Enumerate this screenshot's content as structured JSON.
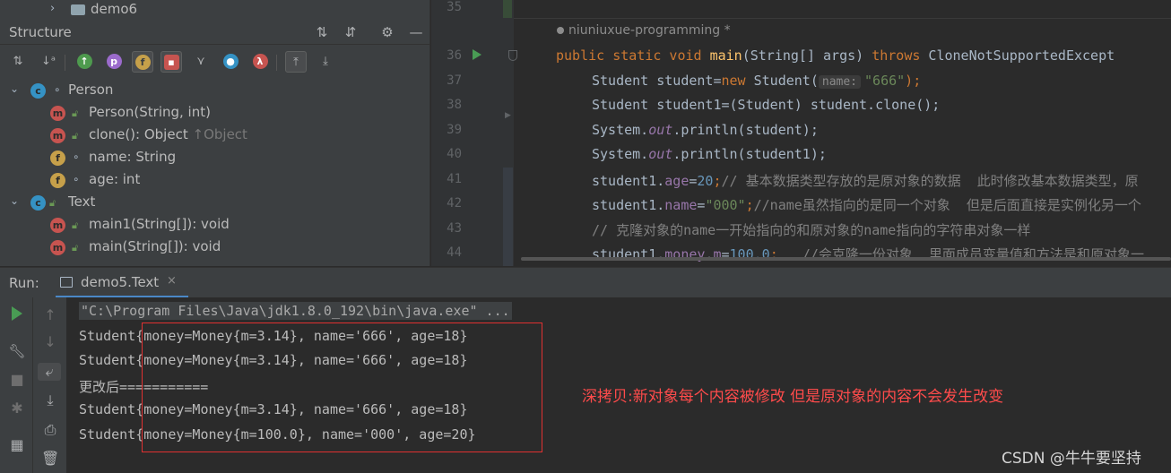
{
  "project_tree": {
    "folder_label": "demo6"
  },
  "structure_panel": {
    "title": "Structure",
    "toolbar_icons": [
      "sort-by-visibility-icon",
      "sort-alphabetically-icon",
      "show-inherited-icon",
      "show-properties-icon",
      "show-fields-icon",
      "show-non-public-icon",
      "show-lambdas-icon",
      "show-anonymous-icon",
      "navigate-from-source-icon",
      "navigate-to-source-icon"
    ],
    "tree": [
      {
        "label": "Person",
        "kind": "class",
        "level": 0,
        "expanded": true
      },
      {
        "label": "Person(String, int)",
        "kind": "method",
        "level": 1
      },
      {
        "label": "clone(): Object",
        "suffix": "↑Object",
        "kind": "method",
        "level": 1
      },
      {
        "label": "name: String",
        "kind": "field",
        "level": 1
      },
      {
        "label": "age: int",
        "kind": "field",
        "level": 1
      },
      {
        "label": "Text",
        "kind": "class",
        "level": 0,
        "expanded": true
      },
      {
        "label": "main1(String[]): void",
        "kind": "method",
        "level": 1
      },
      {
        "label": "main(String[]): void",
        "kind": "method",
        "level": 1
      }
    ]
  },
  "editor": {
    "author_hint": "niuniuxue-programming *",
    "line_numbers": [
      "35",
      "36",
      "37",
      "38",
      "39",
      "40",
      "41",
      "42",
      "43",
      "44"
    ],
    "lines": {
      "l36": {
        "kw1": "public static void ",
        "fn": "main",
        "rest": "(String[] args) ",
        "kw2": "throws",
        "tail": " CloneNotSupportedExcept"
      },
      "l37": {
        "a": "Student student=",
        "kw": "new",
        "b": " Student(",
        "hint": "name:",
        "str": "\"666\"",
        "c": ");"
      },
      "l38": {
        "a": "Student student1=(Student) student.clone();"
      },
      "l39": {
        "a": "System.",
        "out": "out",
        "b": ".println(student);"
      },
      "l40": {
        "a": "System.",
        "out": "out",
        "b": ".println(student1);"
      },
      "l41": {
        "a": "student1.",
        "fld": "age",
        "b": "=",
        "num": "20",
        "c": ";",
        "cmt": "// 基本数据类型存放的是原对象的数据  此时修改基本数据类型，原"
      },
      "l42": {
        "a": "student1.",
        "fld": "name",
        "b": "=",
        "str": "\"000\"",
        "c": ";",
        "cmt": "//name虽然指向的是同一个对象  但是后面直接是实例化另一个"
      },
      "l43": {
        "cmt": "// 克隆对象的name一开始指向的和原对象的name指向的字符串对象一样"
      },
      "l44": {
        "a": "student1.",
        "fld1": "money",
        "b": ".",
        "fld2": "m",
        "c": "=",
        "num": "100.0",
        "d": ";   ",
        "cmt": "//会克隆一份对象  里面成员变量值和方法是和原对象一"
      }
    }
  },
  "run_panel": {
    "label": "Run:",
    "tab_label": "demo5.Text",
    "tab_close": "×",
    "console": [
      "\"C:\\Program Files\\Java\\jdk1.8.0_192\\bin\\java.exe\" ...",
      "Student{money=Money{m=3.14}, name='666', age=18}",
      "Student{money=Money{m=3.14}, name='666', age=18}",
      "更改后===========",
      "Student{money=Money{m=3.14}, name='666', age=18}",
      "Student{money=Money{m=100.0}, name='000', age=20}"
    ],
    "annotation": "深拷贝:新对象每个内容被修改 但是原对象的内容不会发生改变",
    "watermark": "CSDN @牛牛要坚持"
  },
  "colors": {
    "accent": "#4a88c7",
    "run_green": "#499c54",
    "annotation_red": "#ff4b4b",
    "box_red": "#e03131"
  }
}
